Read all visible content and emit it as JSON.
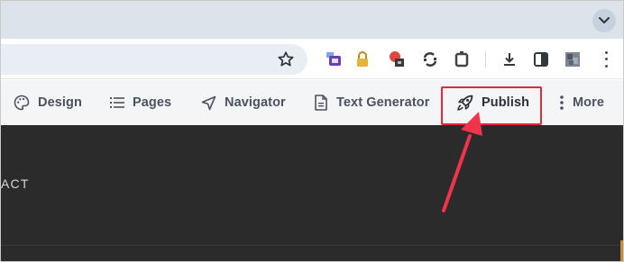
{
  "browser": {
    "tab_search_icon": "chevron-down-icon",
    "address_bar": {
      "bookmark_icon": "star-icon"
    },
    "extensions": [
      "tv-extension-icon",
      "lock-extension-icon",
      "recording-extension-icon",
      "sync-extension-icon",
      "puzzle-extension-icon",
      "download-icon",
      "sidepanel-icon",
      "profile-avatar-icon"
    ],
    "menu_icon": "more-vertical-icon"
  },
  "app_menu": {
    "items": [
      {
        "label": "Design",
        "icon": "palette-icon"
      },
      {
        "label": "Pages",
        "icon": "list-icon"
      },
      {
        "label": "Navigator",
        "icon": "navigation-icon"
      },
      {
        "label": "Text Generator",
        "icon": "document-icon"
      },
      {
        "label": "Publish",
        "icon": "rocket-icon"
      },
      {
        "label": "More",
        "icon": "more-vertical-icon"
      }
    ]
  },
  "canvas": {
    "nav_text": "ACT"
  },
  "annotation": {
    "color": "#e8263a",
    "target": "Publish"
  },
  "colors": {
    "tabstrip": "#dde3ea",
    "appbar": "#f4f5f7",
    "canvas": "#2b2b2b",
    "menu_text": "#4b5260"
  }
}
